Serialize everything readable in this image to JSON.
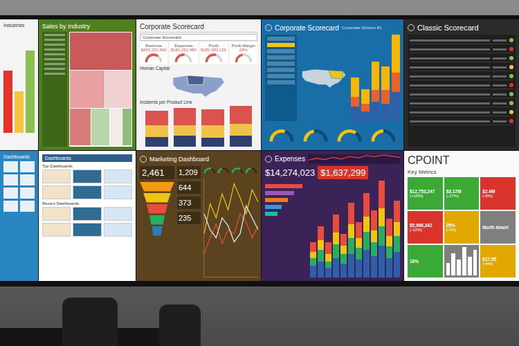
{
  "industries": {
    "title": "Industries",
    "bars": [
      {
        "color": "#e5332a",
        "level": 0.6
      },
      {
        "color": "#f6c342",
        "level": 0.4
      },
      {
        "color": "#8cc152",
        "level": 0.8
      }
    ]
  },
  "sales_by_industry": {
    "title": "Sales by Industry",
    "treemap": [
      {
        "value": 34,
        "color": "#c85a5a"
      },
      {
        "value": 18,
        "color": "#e8a0a0"
      },
      {
        "value": 14,
        "color": "#f0d0d0"
      },
      {
        "value": 12,
        "color": "#d97b7b"
      },
      {
        "value": 10,
        "color": "#b7d7a8"
      },
      {
        "value": 7,
        "color": "#f4eaea"
      },
      {
        "value": 5,
        "color": "#8fbf7a"
      }
    ]
  },
  "corporate_scorecard_light": {
    "title": "Corporate Scorecard",
    "filter": "Corporate Scorecard",
    "kpis": [
      {
        "label": "Revenue",
        "value": "$263,232,990",
        "level": 0.7
      },
      {
        "label": "Expenses",
        "value": "$182,252,480",
        "level": 0.55
      },
      {
        "label": "Profit",
        "value": "$181,083,126",
        "level": 0.6
      },
      {
        "label": "Profit Margin",
        "value": "28%",
        "level": 0.45
      }
    ],
    "map_title": "Human Capital",
    "chart_title": "Incidents per Product Line",
    "series": [
      {
        "color": "#2f3f6e",
        "values": [
          8,
          9,
          7,
          9
        ]
      },
      {
        "color": "#f0c24a",
        "values": [
          10,
          9,
          11,
          10
        ]
      },
      {
        "color": "#d9534f",
        "values": [
          12,
          14,
          13,
          15
        ]
      }
    ]
  },
  "corporate_scorecard_dark": {
    "title": "Corporate Scorecard",
    "subtitle": "Corporate Division #1",
    "list_rows": [
      {
        "selected": false
      },
      {
        "selected": true
      },
      {
        "selected": false
      },
      {
        "selected": false
      },
      {
        "selected": false
      },
      {
        "selected": false
      },
      {
        "selected": false
      },
      {
        "selected": false
      }
    ],
    "series": [
      {
        "color": "#2f5fa8",
        "values": [
          15,
          10,
          20,
          18,
          30
        ]
      },
      {
        "color": "#e8632b",
        "values": [
          10,
          8,
          12,
          14,
          20
        ]
      },
      {
        "color": "#f5b50a",
        "values": [
          20,
          15,
          30,
          25,
          40
        ]
      }
    ],
    "gauges": [
      {
        "level": 0.6
      },
      {
        "level": 0.45
      },
      {
        "level": 0.7
      },
      {
        "level": 0.5
      }
    ]
  },
  "classic_scorecard": {
    "title": "Classic Scorecard",
    "rows": [
      {
        "color": "#8cc152"
      },
      {
        "color": "#e5332a"
      },
      {
        "color": "#8cc152"
      },
      {
        "color": "#f6c342"
      },
      {
        "color": "#8cc152"
      },
      {
        "color": "#e5332a"
      },
      {
        "color": "#8cc152"
      },
      {
        "color": "#8cc152"
      },
      {
        "color": "#f6c342"
      },
      {
        "color": "#e5332a"
      }
    ]
  },
  "dashboards_blue": {
    "title": "Dashboards"
  },
  "dashboards_white": {
    "title": "Dashboards",
    "sections": [
      "Top Dashboards",
      "Recent Dashboards"
    ]
  },
  "marketing_dashboard": {
    "title": "Marketing Dashboard",
    "headline": "2,461",
    "funnel": [
      {
        "level": 1,
        "color": "#f39c12"
      },
      {
        "level": 0.8,
        "color": "#f1c40f"
      },
      {
        "level": 0.62,
        "color": "#e74c3c"
      },
      {
        "level": 0.45,
        "color": "#27ae60"
      },
      {
        "level": 0.3,
        "color": "#2980b9"
      }
    ],
    "metrics": [
      "1,209",
      "644",
      "373",
      "235"
    ],
    "gauges": [
      {
        "level": 0.6
      },
      {
        "level": 0.4
      },
      {
        "level": 0.7
      },
      {
        "level": 0.5
      }
    ],
    "lines": [
      {
        "color": "#f1c40f",
        "values": [
          20,
          35,
          28,
          40,
          32,
          45,
          38,
          30,
          42,
          36
        ]
      },
      {
        "color": "#e74c3c",
        "values": [
          10,
          18,
          25,
          15,
          22,
          20,
          30,
          26,
          18,
          24
        ]
      },
      {
        "color": "#ecf0f1",
        "values": [
          30,
          22,
          18,
          28,
          24,
          16,
          20,
          34,
          28,
          22
        ]
      }
    ]
  },
  "expenses": {
    "title": "Expenses",
    "total": "$14,274,023",
    "highlight": "$1,637,299",
    "hbars": [
      {
        "color": "#e74c3c",
        "level": 0.9
      },
      {
        "color": "#9b59b6",
        "level": 0.7
      },
      {
        "color": "#e67e22",
        "level": 0.55
      },
      {
        "color": "#3498db",
        "level": 0.4
      },
      {
        "color": "#1abc9c",
        "level": 0.3
      }
    ],
    "trend": [
      12,
      18,
      14,
      22,
      16,
      25,
      20,
      28,
      24,
      30,
      26,
      22
    ],
    "series": [
      {
        "color": "#2f5fa8",
        "values": [
          6,
          8,
          5,
          10,
          7,
          12,
          9,
          14,
          11,
          16,
          10,
          13
        ]
      },
      {
        "color": "#27ae60",
        "values": [
          4,
          6,
          3,
          7,
          5,
          8,
          6,
          9,
          7,
          10,
          6,
          8
        ]
      },
      {
        "color": "#f1c40f",
        "values": [
          3,
          5,
          4,
          6,
          4,
          7,
          5,
          8,
          6,
          9,
          5,
          7
        ]
      },
      {
        "color": "#e74c3c",
        "values": [
          5,
          7,
          6,
          9,
          6,
          11,
          8,
          12,
          10,
          14,
          9,
          11
        ]
      }
    ]
  },
  "cpoint": {
    "title": "CPOINT",
    "subtitle": "Key Metrics",
    "cards": [
      {
        "kind": "metric",
        "main": "$12,753,247",
        "delta": "(+15%)",
        "color": "#3aa935"
      },
      {
        "kind": "metric",
        "main": "$3.17M",
        "delta": "(-17%)",
        "color": "#3aa935"
      },
      {
        "kind": "metric",
        "main": "$2.4M",
        "delta": "(-8%)",
        "color": "#d9342b"
      },
      {
        "kind": "metric",
        "main": "$5,966,342",
        "delta": "(-12%)",
        "color": "#d9342b"
      },
      {
        "kind": "metric",
        "main": "25%",
        "delta": "(-2%)",
        "color": "#e0a800"
      },
      {
        "kind": "metric",
        "main": "North Ameri",
        "delta": "",
        "color": "#7f7f7f"
      },
      {
        "kind": "metric",
        "main": "18%",
        "delta": "",
        "color": "#3aa935"
      },
      {
        "kind": "chart",
        "values": [
          4,
          7,
          5,
          9,
          6,
          8
        ],
        "color": "#7f7f7f"
      },
      {
        "kind": "metric",
        "main": "$17.55",
        "delta": "(-4%)",
        "color": "#e0a800"
      }
    ]
  }
}
